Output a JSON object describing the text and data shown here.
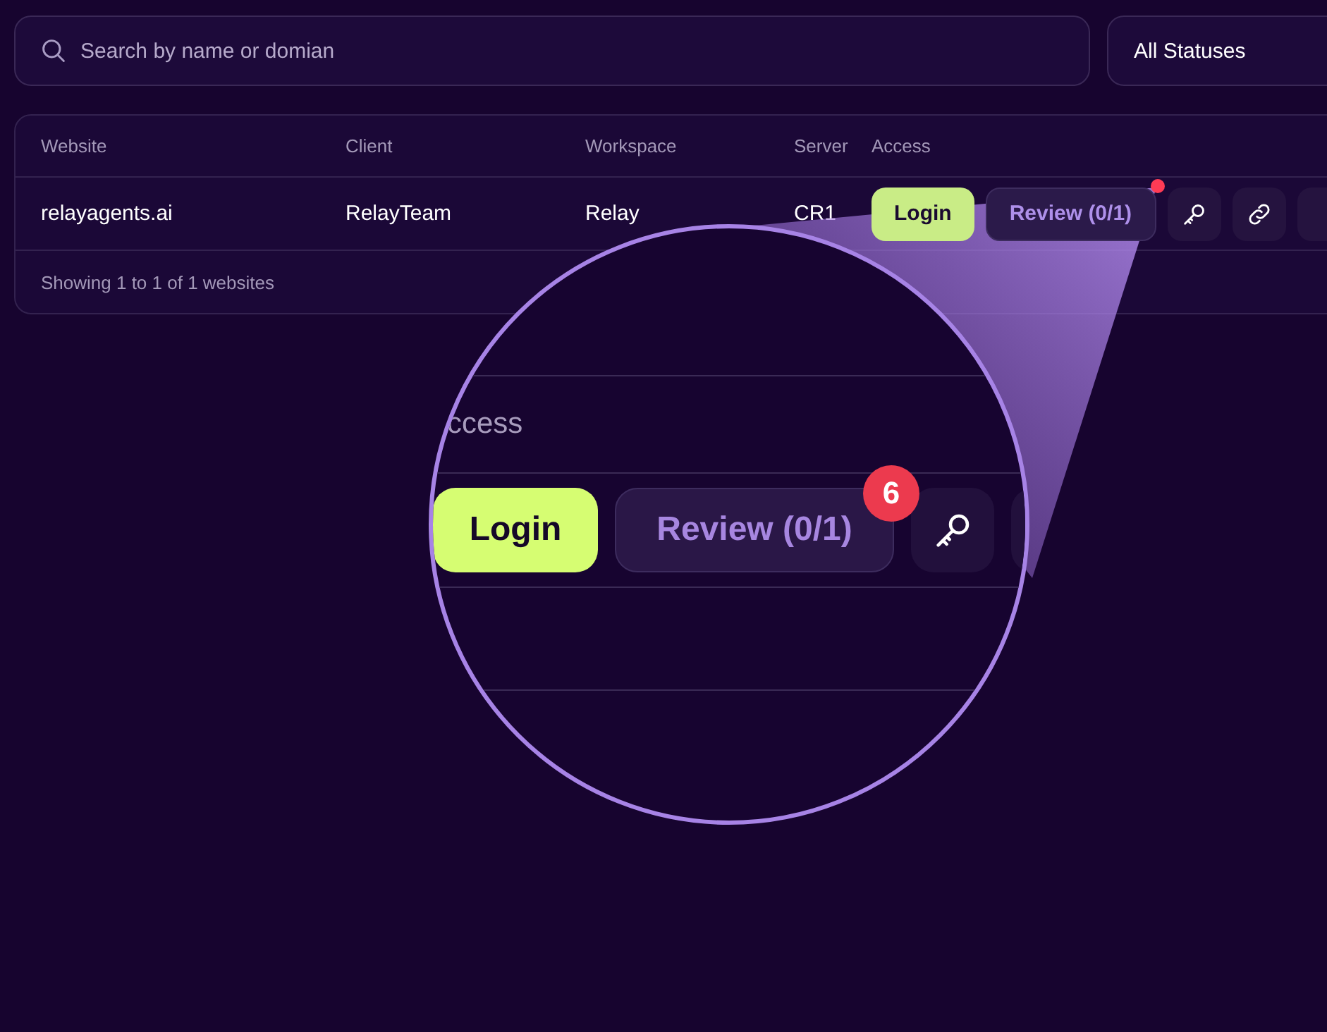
{
  "search": {
    "placeholder": "Search by name or domian"
  },
  "status_filter": {
    "value": "All Statuses"
  },
  "table": {
    "columns": [
      "Website",
      "Client",
      "Workspace",
      "Server",
      "Access"
    ],
    "rows": [
      {
        "website": "relayagents.ai",
        "client": "RelayTeam",
        "workspace": "Relay",
        "server": "CR1",
        "actions": [
          {
            "kind": "login",
            "label": "Login"
          },
          {
            "kind": "review",
            "label": "Review (0/1)",
            "notification": true
          },
          {
            "kind": "key"
          },
          {
            "kind": "link"
          },
          {
            "kind": "partial"
          }
        ]
      }
    ],
    "footer": "Showing 1 to 1 of 1 websites"
  },
  "magnifier": {
    "header_fragment": "ccess",
    "actions": [
      {
        "kind": "login",
        "label": "Login"
      },
      {
        "kind": "review",
        "label": "Review (0/1)",
        "badge": "6"
      },
      {
        "kind": "key"
      },
      {
        "kind": "partial"
      }
    ]
  }
}
